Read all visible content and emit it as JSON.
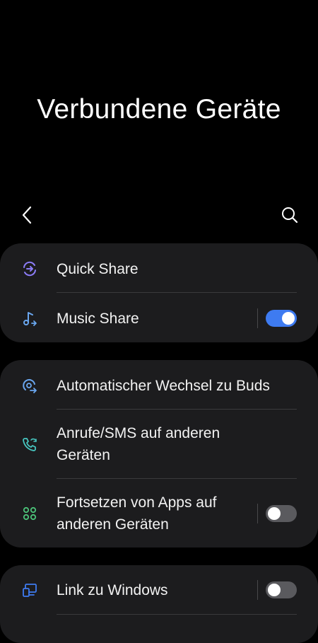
{
  "header": {
    "title": "Verbundene Geräte"
  },
  "colors": {
    "accent": "#3e7bf1",
    "card_bg": "#1c1c1e",
    "toggle_off": "#5a5a5e"
  },
  "card1": {
    "items": [
      {
        "label": "Quick Share",
        "icon": "quick-share-icon"
      },
      {
        "label": "Music Share",
        "icon": "music-share-icon",
        "toggle": true
      }
    ]
  },
  "card2": {
    "items": [
      {
        "label": "Automatischer Wechsel zu Buds",
        "icon": "auto-switch-buds-icon"
      },
      {
        "label": "Anrufe/SMS auf anderen Geräten",
        "icon": "calls-sms-icon"
      },
      {
        "label": "Fortsetzen von Apps auf anderen Geräten",
        "icon": "continue-apps-icon",
        "toggle": false
      }
    ]
  },
  "card3": {
    "items": [
      {
        "label": "Link zu Windows",
        "icon": "link-to-windows-icon",
        "toggle": false
      }
    ]
  }
}
